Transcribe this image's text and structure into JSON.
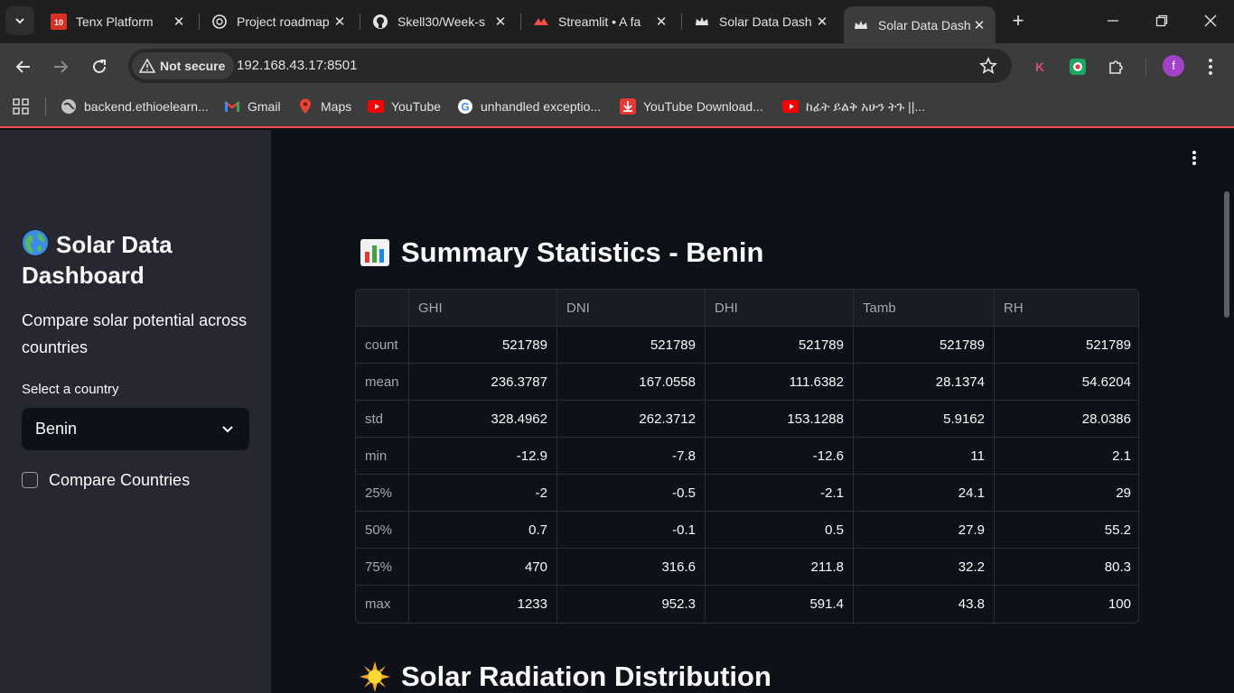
{
  "browser": {
    "tabs": [
      {
        "title": "Tenx Platform",
        "icon": "tenx-icon"
      },
      {
        "title": "Project roadmap",
        "icon": "chatgpt-icon"
      },
      {
        "title": "Skell30/Week-s",
        "icon": "github-icon"
      },
      {
        "title": "Streamlit • A fa",
        "icon": "streamlit-icon"
      },
      {
        "title": "Solar Data Dash",
        "icon": "streamlit-crown-icon"
      },
      {
        "title": "Solar Data Dash",
        "icon": "streamlit-crown-icon",
        "active": true
      }
    ],
    "security_label": "Not secure",
    "url": "192.168.43.17:8501",
    "profile_initial": "f",
    "bookmarks": [
      {
        "label": "backend.ethioelearn...",
        "icon": "globe-icon"
      },
      {
        "label": "Gmail",
        "icon": "gmail-icon"
      },
      {
        "label": "Maps",
        "icon": "maps-icon"
      },
      {
        "label": "YouTube",
        "icon": "youtube-icon"
      },
      {
        "label": "unhandled exceptio...",
        "icon": "google-icon"
      },
      {
        "label": "YouTube Download...",
        "icon": "download-icon"
      },
      {
        "label": "ከፊት ይልቅ አሁን ትጉ ||...",
        "icon": "youtube-icon"
      }
    ],
    "colors": {
      "accent": "#ff4b4b",
      "chrome": "#3c3c3c",
      "tabbar": "#1f1f1f"
    }
  },
  "sidebar": {
    "title": "Solar Data Dashboard",
    "title_icon": "globe-emoji",
    "subtitle": "Compare solar potential across countries",
    "select_label": "Select a country",
    "select_value": "Benin",
    "compare_label": "Compare Countries",
    "compare_checked": false
  },
  "main": {
    "summary_title": "Summary Statistics - Benin",
    "summary_icon": "bar-chart-emoji",
    "table": {
      "columns": [
        "",
        "GHI",
        "DNI",
        "DHI",
        "Tamb",
        "RH"
      ],
      "rows": [
        [
          "count",
          "521789",
          "521789",
          "521789",
          "521789",
          "521789"
        ],
        [
          "mean",
          "236.3787",
          "167.0558",
          "111.6382",
          "28.1374",
          "54.6204"
        ],
        [
          "std",
          "328.4962",
          "262.3712",
          "153.1288",
          "5.9162",
          "28.0386"
        ],
        [
          "min",
          "-12.9",
          "-7.8",
          "-12.6",
          "11",
          "2.1"
        ],
        [
          "25%",
          "-2",
          "-0.5",
          "-2.1",
          "24.1",
          "29"
        ],
        [
          "50%",
          "0.7",
          "-0.1",
          "0.5",
          "27.9",
          "55.2"
        ],
        [
          "75%",
          "470",
          "316.6",
          "211.8",
          "32.2",
          "80.3"
        ],
        [
          "max",
          "1233",
          "952.3",
          "591.4",
          "43.8",
          "100"
        ]
      ]
    },
    "distribution_title": "Solar Radiation Distribution",
    "distribution_icon": "sun-emoji"
  }
}
